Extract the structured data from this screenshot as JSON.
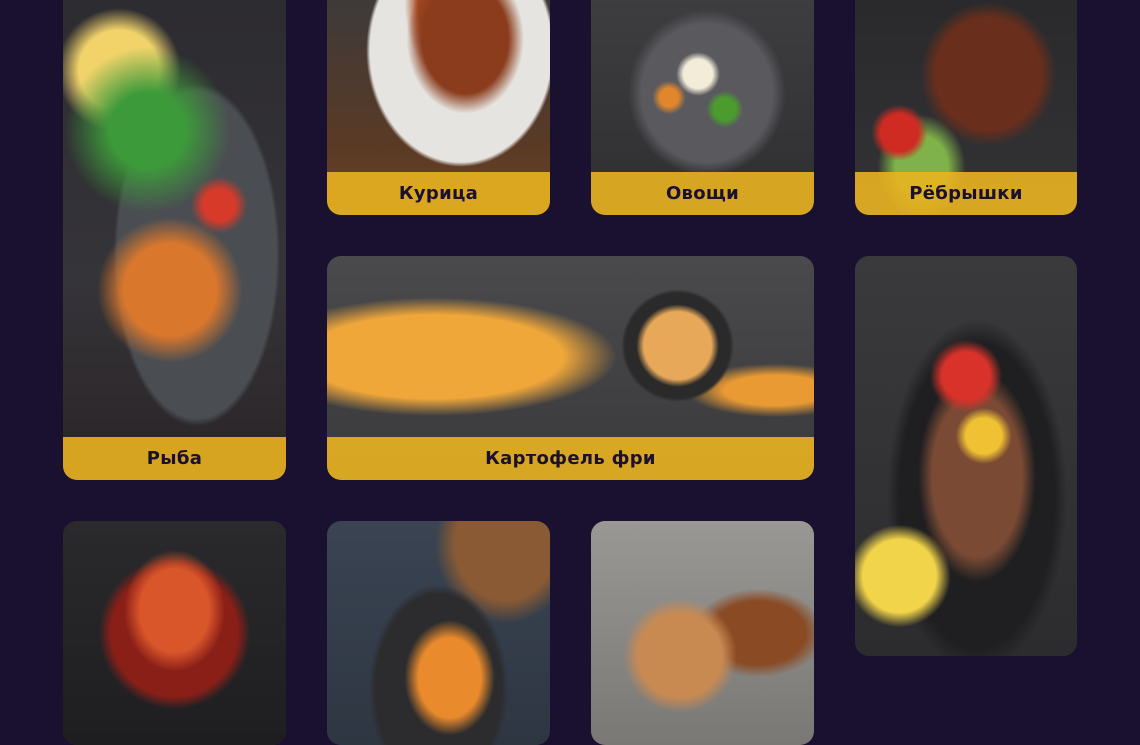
{
  "menu": {
    "categories": [
      {
        "label": "Рыба",
        "icon": "fish-photo"
      },
      {
        "label": "Курица",
        "icon": "chicken-photo"
      },
      {
        "label": "Овощи",
        "icon": "vegetables-photo"
      },
      {
        "label": "Рёбрышки",
        "icon": "ribs-photo"
      },
      {
        "label": "Картофель фри",
        "icon": "fries-photo"
      },
      {
        "label": "",
        "icon": "kebab-photo"
      },
      {
        "label": "",
        "icon": "shrimp-photo"
      },
      {
        "label": "",
        "icon": "sweet-potato-photo"
      },
      {
        "label": "",
        "icon": "pastry-photo"
      }
    ]
  },
  "colors": {
    "background": "#1a1130",
    "label_bar": "#e9b220",
    "label_text": "#1a1130"
  }
}
